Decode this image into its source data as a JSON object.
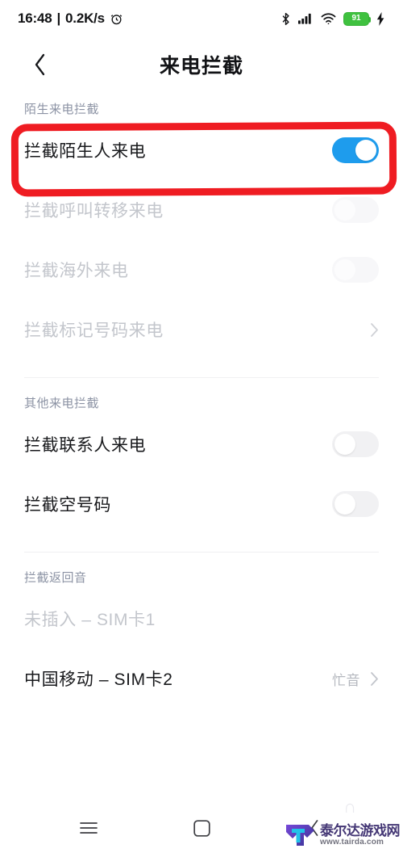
{
  "statusbar": {
    "time": "16:48",
    "separator": "|",
    "network_speed": "0.2K/s",
    "alarm_icon": "alarm-clock-icon",
    "bluetooth_icon": "bluetooth-icon",
    "signal_icon": "cellular-signal-icon",
    "wifi_icon": "wifi-icon",
    "battery_level": "91",
    "charging_icon": "charging-bolt-icon",
    "battery_color": "#3fc13f"
  },
  "header": {
    "back_icon": "back-chevron-icon",
    "title": "来电拦截"
  },
  "sections": [
    {
      "header": "陌生来电拦截",
      "rows": [
        {
          "label": "拦截陌生人来电",
          "control": "toggle",
          "state": "on",
          "disabled": false,
          "highlighted": true
        },
        {
          "label": "拦截呼叫转移来电",
          "control": "toggle",
          "state": "off",
          "disabled": true,
          "highlighted": false
        },
        {
          "label": "拦截海外来电",
          "control": "toggle",
          "state": "off",
          "disabled": true,
          "highlighted": false
        },
        {
          "label": "拦截标记号码来电",
          "control": "chevron",
          "state": "",
          "disabled": true,
          "highlighted": false
        }
      ]
    },
    {
      "header": "其他来电拦截",
      "rows": [
        {
          "label": "拦截联系人来电",
          "control": "toggle",
          "state": "off",
          "disabled": false,
          "highlighted": false
        },
        {
          "label": "拦截空号码",
          "control": "toggle",
          "state": "off",
          "disabled": false,
          "highlighted": false
        }
      ]
    },
    {
      "header": "拦截返回音",
      "rows": [
        {
          "label": "未插入 – SIM卡1",
          "control": "none",
          "state": "",
          "disabled": true,
          "highlighted": false
        },
        {
          "label": "中国移动 – SIM卡2",
          "control": "chevron",
          "value": "忙音",
          "state": "",
          "disabled": false,
          "highlighted": false
        }
      ]
    }
  ],
  "annotation": {
    "shape": "red-rounded-rectangle",
    "color": "#ef1c22",
    "targets_row": "拦截陌生人来电"
  },
  "navbar": {
    "recent_icon": "recent-apps-icon",
    "home_icon": "home-square-icon",
    "back_icon": "nav-back-icon"
  },
  "watermark": {
    "logo_icon": "tairda-t-logo-icon",
    "site_name": "泰尔达游戏网",
    "site_url": "www.tairda.com"
  },
  "theme": {
    "accent_on": "#1e9ced",
    "section_header": "#8c93a4",
    "text_primary": "#18191c",
    "text_disabled": "#c3c6cc",
    "divider": "#f0f0f2",
    "background": "#ffffff"
  }
}
